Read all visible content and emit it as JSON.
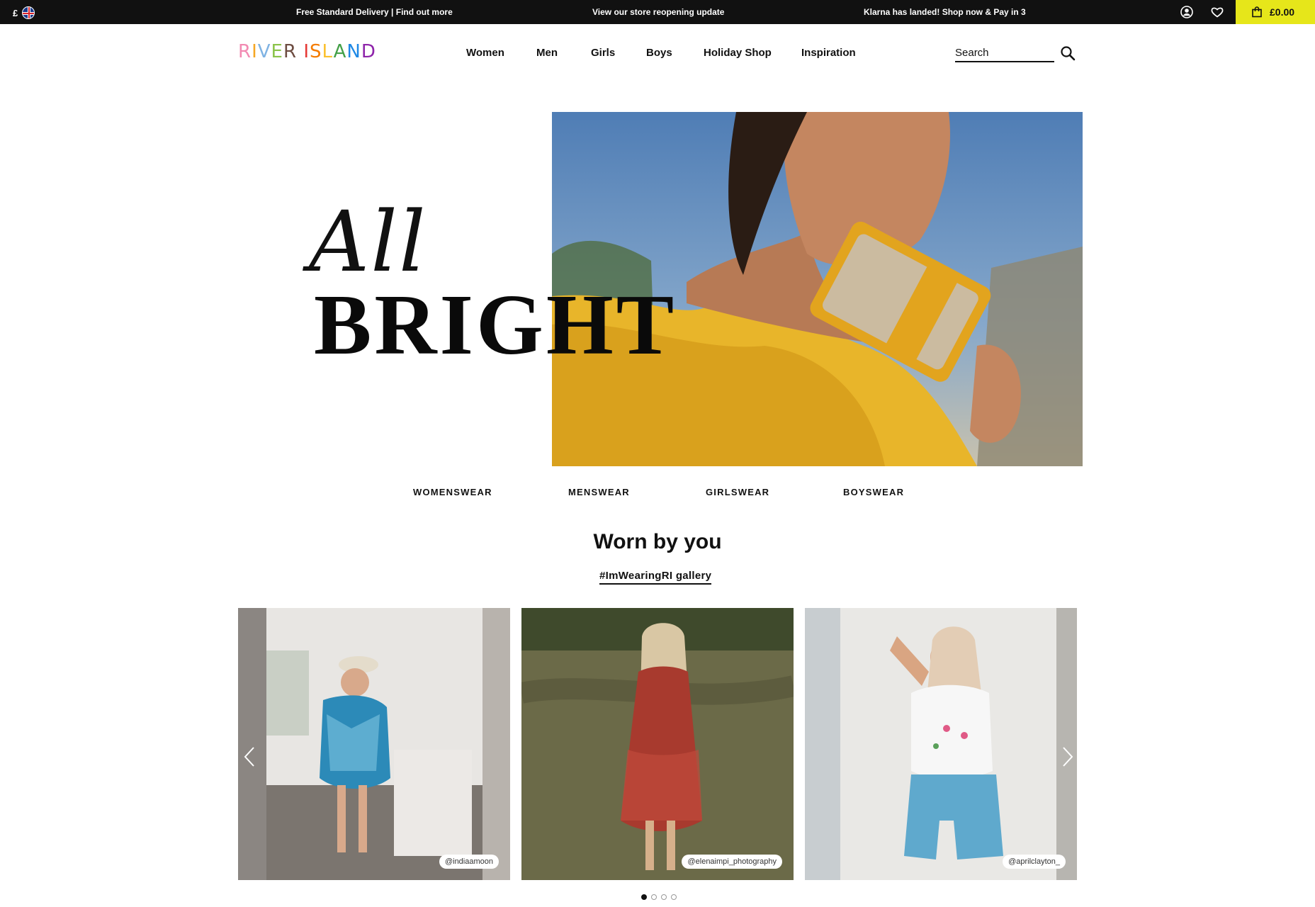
{
  "topbar": {
    "currency": "£",
    "messages": [
      "Free Standard Delivery | Find out more",
      "View our store reopening update",
      "Klarna has landed! Shop now & Pay in 3"
    ],
    "basket_total": "£0.00",
    "icons": [
      "user-icon",
      "heart-icon",
      "bag-icon"
    ],
    "basket_color": "#e6e61a"
  },
  "header": {
    "logo": [
      "RIVER",
      "ISLAND"
    ],
    "nav": [
      "Women",
      "Men",
      "Girls",
      "Boys",
      "Holiday Shop",
      "Inspiration"
    ],
    "search_placeholder": "Search"
  },
  "hero": {
    "line1": "All",
    "line2": "BRIGHT"
  },
  "categories": [
    "WOMENSWEAR",
    "MENSWEAR",
    "GIRLSWEAR",
    "BOYSWEAR"
  ],
  "worn_by_you": {
    "title": "Worn by you",
    "gallery_link": "#ImWearingRI gallery",
    "cards": [
      {
        "handle": "@indiaamoon"
      },
      {
        "handle": "@elenaimpi_photography"
      },
      {
        "handle": "@aprilclayton_"
      }
    ],
    "carousel_pages": 4,
    "active_page": 1
  }
}
